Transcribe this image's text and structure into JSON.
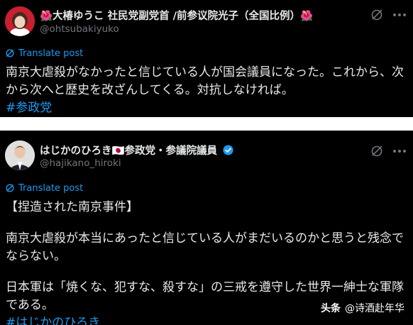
{
  "posts": [
    {
      "display_name": "🌺大椿ゆうこ 社民党副党首 /前参议院光子（全国比例）🌺",
      "handle": "@ohtsubakiyuko",
      "translate_label": "Translate post",
      "body_lines": [
        "南京大虐殺がなかったと信じている人が国会議員になった。これから、次",
        "から次へと歴史を改ざんしてくる。対抗しなければ。"
      ],
      "hashtag": "#参政党"
    },
    {
      "display_name": "はじかのひろき🇯🇵参政党・参議院議員",
      "handle": "@hajikano_hiroki",
      "translate_label": "Translate post",
      "paragraph1": "【捏造された南京事件】",
      "paragraph2_lines": [
        "南京大虐殺が本当にあったと信じている人がまだいるのかと思うと残念で",
        "ならない。"
      ],
      "paragraph3_lines": [
        "日本軍は「焼くな、犯すな、殺すな」の三戒を遵守した世界一紳士な軍隊",
        "である。"
      ],
      "hashtag": "#はじかのひろき"
    }
  ],
  "watermark": {
    "brand": "头条",
    "author": "@诗酒赴年华"
  },
  "colors": {
    "background": "#000000",
    "text": "#e7e9ea",
    "secondary_text": "#71767b",
    "link": "#1d9bf0",
    "verified_badge": "#1d9bf0"
  },
  "icons": [
    "grok-icon",
    "more-icon",
    "translate-icon",
    "verified-badge-icon",
    "avatar"
  ]
}
